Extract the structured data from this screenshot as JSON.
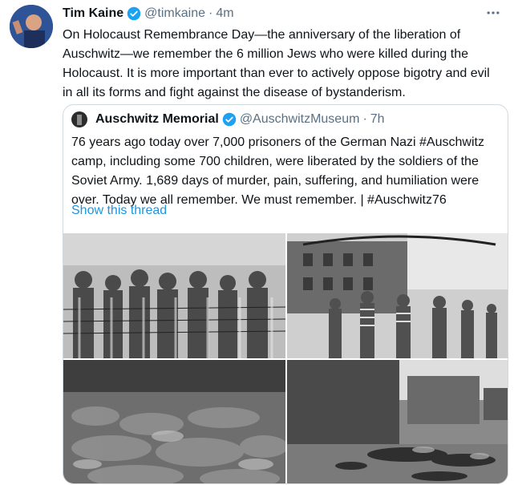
{
  "tweet": {
    "author_name": "Tim Kaine",
    "handle": "@timkaine",
    "separator": "·",
    "time": "4m",
    "more_icon": "more-dots-icon",
    "text": "On Holocaust Remembrance Day—the anniversary of the liberation of Auschwitz—we remember the 6 million Jews who were killed during the Holocaust. It is more important than ever to actively oppose bigotry and evil in all its forms and fight against the disease of bystanderism."
  },
  "quoted": {
    "author_name": "Auschwitz Memorial",
    "handle": "@AuschwitzMuseum",
    "separator": "·",
    "time": "7h",
    "text": "76 years ago today over 7,000 prisoners of the German Nazi #Auschwitz camp, including some 700 children, were liberated by the soldiers of the Soviet Army. 1,689 days of murder, pain, suffering, and humiliation were over. Today we all remember. We must remember. | #Auschwitz76",
    "show_thread": "Show this thread",
    "photos": [
      "photo-children-behind-fence",
      "photo-liberated-prisoners-at-gate",
      "photo-piles-of-clothing",
      "photo-camp-barracks"
    ]
  },
  "colors": {
    "link": "#1b95e0",
    "muted": "#5b7083",
    "verified": "#1da1f2",
    "border": "#cfd9de"
  }
}
